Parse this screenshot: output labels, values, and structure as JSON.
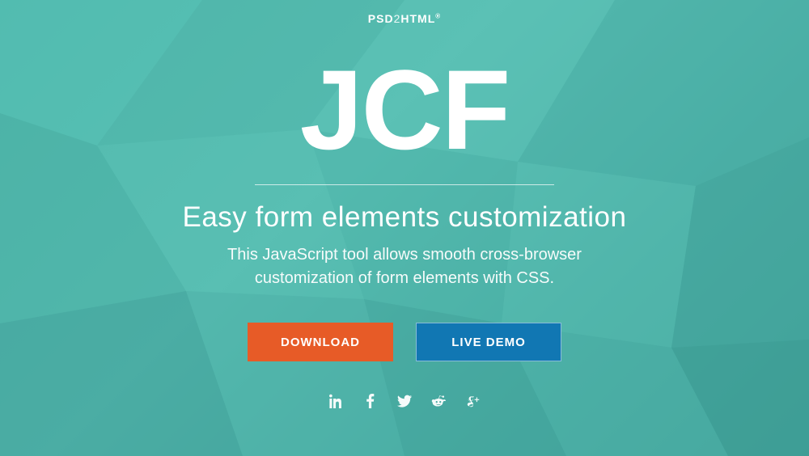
{
  "brand": {
    "left": "PSD",
    "mid": "2",
    "right": "HTML",
    "mark": "®"
  },
  "hero": {
    "logo": "JCF",
    "tagline": "Easy form elements customization",
    "description": "This JavaScript tool allows smooth cross-browser customization of form elements with CSS."
  },
  "buttons": {
    "primary": "DOWNLOAD",
    "secondary": "LIVE DEMO"
  },
  "social": {
    "linkedin": "linkedin-icon",
    "facebook": "facebook-icon",
    "twitter": "twitter-icon",
    "reddit": "reddit-icon",
    "gplus": "googleplus-icon"
  },
  "colors": {
    "accent": "#e75b27",
    "secondary": "#1177b3",
    "bg": "#4fb9ad"
  }
}
